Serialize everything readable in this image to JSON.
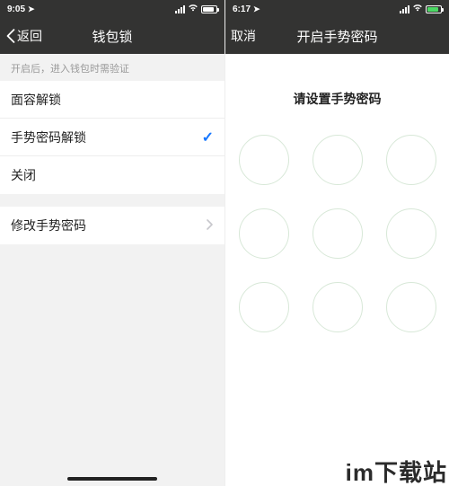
{
  "left": {
    "status": {
      "time": "9:05"
    },
    "nav": {
      "back": "返回",
      "title": "钱包锁"
    },
    "hint": "开启后，进入钱包时需验证",
    "options": {
      "face": "面容解锁",
      "gesture": "手势密码解锁",
      "off": "关闭"
    },
    "modify": "修改手势密码"
  },
  "right": {
    "status": {
      "time": "6:17"
    },
    "nav": {
      "cancel": "取消",
      "title": "开启手势密码"
    },
    "instruction": "请设置手势密码"
  },
  "watermark": "im下载站"
}
